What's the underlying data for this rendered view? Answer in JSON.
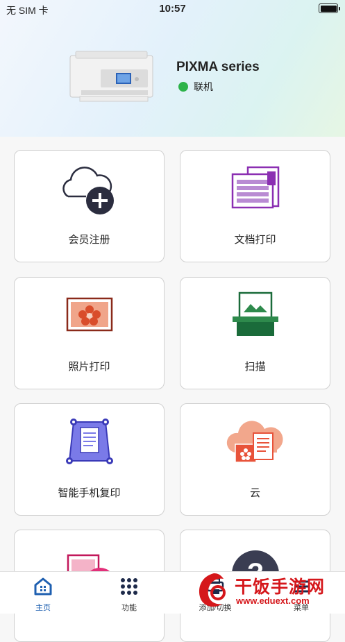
{
  "status_bar": {
    "carrier": "无 SIM 卡",
    "time": "10:57"
  },
  "printer": {
    "name": "PIXMA series",
    "status": "联机",
    "status_color": "#2db34a"
  },
  "menu": [
    {
      "label": "会员注册",
      "icon": "cloud-add-icon"
    },
    {
      "label": "文档打印",
      "icon": "document-print-icon"
    },
    {
      "label": "照片打印",
      "icon": "photo-print-icon"
    },
    {
      "label": "扫描",
      "icon": "scan-icon"
    },
    {
      "label": "智能手机复印",
      "icon": "smartphone-copy-icon"
    },
    {
      "label": "云",
      "icon": "cloud-icon"
    },
    {
      "label": "",
      "icon": "photo-edit-icon"
    },
    {
      "label": "",
      "icon": "help-icon"
    }
  ],
  "tabs": [
    {
      "label": "主页",
      "icon": "home-icon"
    },
    {
      "label": "功能",
      "icon": "grid-icon"
    },
    {
      "label": "添加/切换",
      "icon": "printer-switch-icon"
    },
    {
      "label": "菜单",
      "icon": "menu-icon"
    }
  ],
  "watermark": {
    "text": "干饭手游网",
    "url": "www.eduext.com"
  },
  "colors": {
    "accent": "#1e5fb0",
    "online": "#2db34a",
    "watermark": "#d5171b"
  }
}
